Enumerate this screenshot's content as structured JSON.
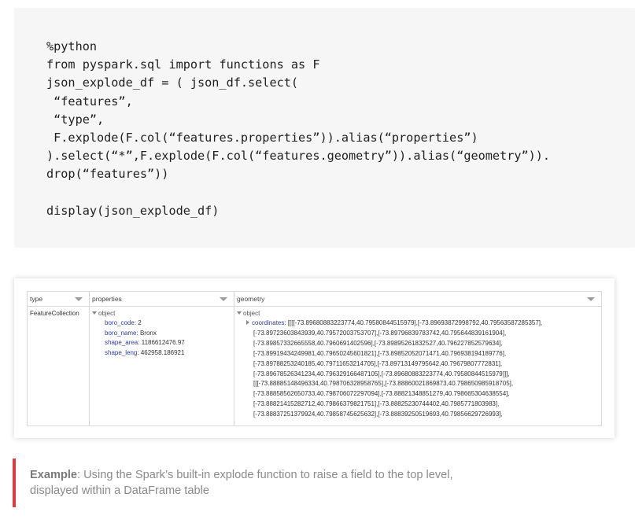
{
  "code": {
    "text": "%python\nfrom pyspark.sql import functions as F\njson_explode_df = ( json_df.select(\n “features”,\n “type”,\n F.explode(F.col(“features.properties”)).alias(“properties”)\n).select(“*”,F.explode(F.col(“features.geometry”)).alias(“geometry”)).\ndrop(“features”))\n\ndisplay(json_explode_df)"
  },
  "table": {
    "columns": [
      "type",
      "properties",
      "geometry"
    ],
    "type_value": "FeatureCollection",
    "properties_label": "object",
    "properties": [
      {
        "key": "boro_code",
        "value": "2"
      },
      {
        "key": "boro_name",
        "value": "Bronx"
      },
      {
        "key": "shape_area",
        "value": "1186612476.97"
      },
      {
        "key": "shape_leng",
        "value": "462958.186921"
      }
    ],
    "geometry_label": "object",
    "coordinates_key": "coordinates",
    "coordinates_lines": [
      "[[[[-73.89680883223774,40.79580844515979],[-73.89693872998792,40.79563587285357],",
      "[-73.89723603843939,40.79572003753707],[-73.89796839783742,40.795644839161904],",
      "[-73.89857332665558,40.7960691402596],[-73.89895261832527,40.796227852579634],",
      "[-73.89919434249981,40.79650245601821],[-73.89852052071471,40.796938194189776],",
      "[-73.89788253240185,40.79711653214705],[-73.89713149795642,40.79679807772831],",
      "[-73.89678526341234,40.796329166487105],[-73.89680883223774,40.79580844515979]]],",
      "[[[-73.88885148496334,40.798706328958765],[-73.88860021869873,40.798650985918705],",
      "[-73.88858562650733,40.798706072297094],[-73.88821348851279,40.798665304638554],",
      "[-73.88821415282712,40.79866379821751],[-73.88825230744402,40.7985771803983],",
      "[-73.88837251379924,40.79858745625632],[-73.88839250519693,40.79856629726993],"
    ]
  },
  "caption": {
    "label": "Example",
    "text": ": Using the Spark’s built-in explode function to raise a field to the top level, displayed within a DataFrame table"
  },
  "colors": {
    "accent_bar": "#e03a3e",
    "key_text": "#2f3d9c",
    "code_bg": "#f6f6f6"
  },
  "icons": [
    "sort-triangle-icon",
    "expand-triangle-icon",
    "collapse-triangle-icon"
  ]
}
